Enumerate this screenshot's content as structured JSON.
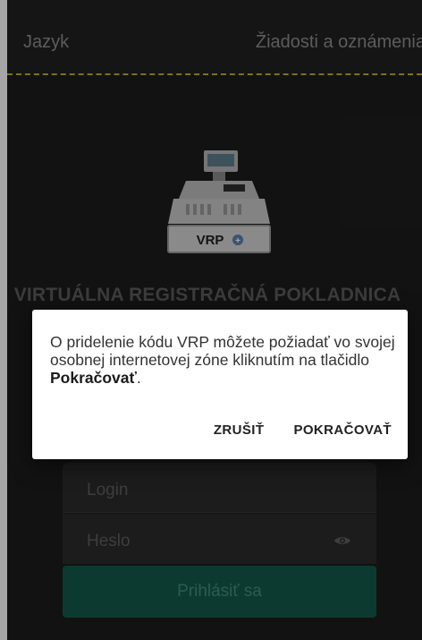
{
  "topbar": {
    "language_label": "Jazyk",
    "requests_label": "Žiadosti a oznámenia",
    "accent_color": "#bfae2a"
  },
  "logo": {
    "icon": "cash-register-icon",
    "plate_text": "VRP"
  },
  "app_title": "VIRTUÁLNA REGISTRAČNÁ POKLADNICA",
  "login_form": {
    "login_placeholder": "Login",
    "password_placeholder": "Heslo",
    "password_toggle_icon": "eye-icon",
    "submit_label": "Prihlásiť sa",
    "submit_color": "#14594a"
  },
  "dialog": {
    "message_text": "O pridelenie kódu VRP môžete požiadať vo svojej osobnej internetovej zóne kliknutím na tlačidlo ",
    "message_bold": "Pokračovať",
    "message_end": ".",
    "cancel_label": "ZRUŠIŤ",
    "continue_label": "POKRAČOVAŤ"
  }
}
